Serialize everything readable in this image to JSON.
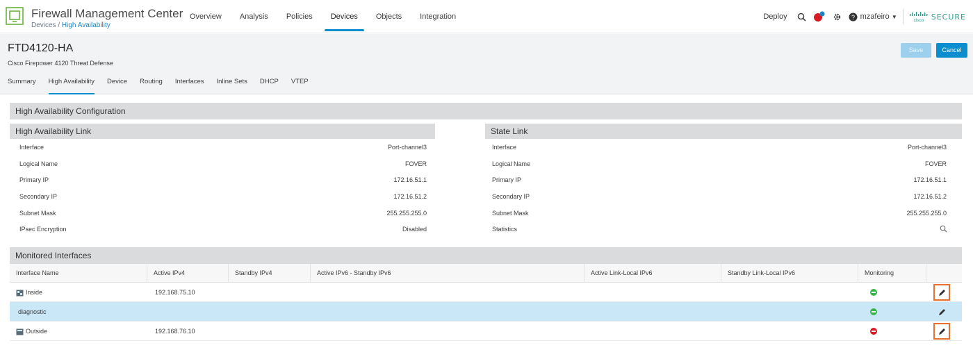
{
  "app": {
    "title": "Firewall Management Center",
    "breadcrumb_root": "Devices /",
    "breadcrumb_current": "High Availability"
  },
  "nav": {
    "items": [
      "Overview",
      "Analysis",
      "Policies",
      "Devices",
      "Objects",
      "Integration"
    ],
    "active": "Devices"
  },
  "header_right": {
    "deploy": "Deploy",
    "user": "mzafeiro",
    "brand": "SECURE",
    "notification_badge_color": "#1a85c7",
    "alert_color": "#d81b25"
  },
  "device": {
    "name": "FTD4120-HA",
    "model": "Cisco Firepower 4120 Threat Defense",
    "save_label": "Save",
    "cancel_label": "Cancel",
    "tabs": [
      "Summary",
      "High Availability",
      "Device",
      "Routing",
      "Interfaces",
      "Inline Sets",
      "DHCP",
      "VTEP"
    ],
    "active_tab": "High Availability"
  },
  "ha": {
    "section_title": "High Availability Configuration",
    "ha_link": {
      "title": "High Availability Link",
      "rows": [
        {
          "label": "Interface",
          "value": "Port-channel3"
        },
        {
          "label": "Logical Name",
          "value": "FOVER"
        },
        {
          "label": "Primary IP",
          "value": "172.16.51.1"
        },
        {
          "label": "Secondary IP",
          "value": "172.16.51.2"
        },
        {
          "label": "Subnet Mask",
          "value": "255.255.255.0"
        },
        {
          "label": "IPsec Encryption",
          "value": "Disabled"
        }
      ]
    },
    "state_link": {
      "title": "State Link",
      "rows": [
        {
          "label": "Interface",
          "value": "Port-channel3"
        },
        {
          "label": "Logical Name",
          "value": "FOVER"
        },
        {
          "label": "Primary IP",
          "value": "172.16.51.1"
        },
        {
          "label": "Secondary IP",
          "value": "172.16.51.2"
        },
        {
          "label": "Subnet Mask",
          "value": "255.255.255.0"
        },
        {
          "label": "Statistics",
          "value": ""
        }
      ]
    }
  },
  "monitored": {
    "title": "Monitored Interfaces",
    "columns": [
      "Interface Name",
      "Active IPv4",
      "Standby IPv4",
      "Active IPv6 - Standby IPv6",
      "Active Link-Local IPv6",
      "Standby Link-Local IPv6",
      "Monitoring",
      ""
    ],
    "rows": [
      {
        "name": "Inside",
        "active_ipv4": "192.168.75.10",
        "monitoring": "enabled",
        "selected": false,
        "edit_highlighted": true
      },
      {
        "name": "diagnostic",
        "active_ipv4": "",
        "monitoring": "enabled",
        "selected": true,
        "edit_highlighted": false
      },
      {
        "name": "Outside",
        "active_ipv4": "192.168.76.10",
        "monitoring": "disabled",
        "selected": false,
        "edit_highlighted": true
      }
    ]
  },
  "colors": {
    "accent": "#0a8ed0",
    "monitor_on": "#3ab54a",
    "monitor_off": "#d81b25",
    "highlight_box": "#e8702a",
    "selected_row": "#c9e7f7"
  }
}
